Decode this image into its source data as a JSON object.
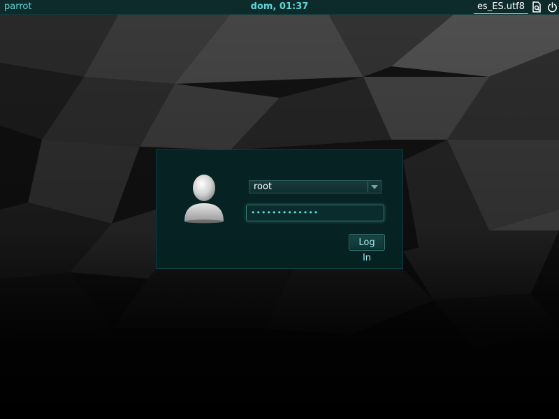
{
  "topbar": {
    "hostname": "parrot",
    "clock": "dom, 01:37",
    "locale": "es_ES.utf8",
    "icons": [
      "accessibility-icon",
      "power-icon"
    ]
  },
  "login": {
    "username": "root",
    "password_mask": "•••••••••••••",
    "login_label": "Log In",
    "avatar_icon": "user-avatar-icon"
  },
  "colors": {
    "accent": "#5fd7d7",
    "topbar_bg": "#0d2b2b",
    "panel_bg": "#062424"
  }
}
